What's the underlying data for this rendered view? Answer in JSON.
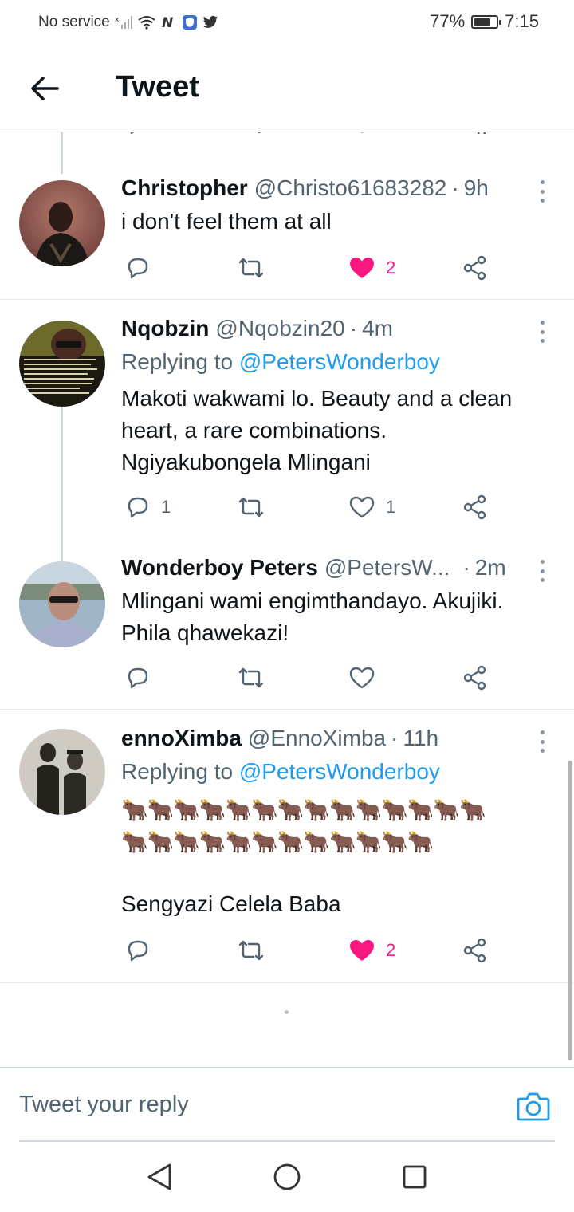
{
  "status_bar": {
    "carrier": "No service",
    "battery_percent": "77%",
    "battery_level": 0.77,
    "time": "7:15"
  },
  "header": {
    "title": "Tweet",
    "back_icon": "arrow-left-icon"
  },
  "colors": {
    "accent": "#1d9bf0",
    "like": "#f91880",
    "secondary_text": "#536471",
    "icon": "#536471"
  },
  "tweets": [
    {
      "name": "Christopher",
      "handle": "@Christo61683282",
      "time": "9h",
      "text": "i don't feel them at all",
      "replies": "",
      "retweets": "",
      "likes": "2",
      "liked": true
    },
    {
      "name": "Nqobzin",
      "handle": "@Nqobzin20",
      "time": "4m",
      "replying_label": "Replying to",
      "replying_to": "@PetersWonderboy",
      "text": "Makoti wakwami lo. Beauty and a clean heart, a rare combinations. Ngiyakubongela Mlingani",
      "replies": "1",
      "retweets": "",
      "likes": "1",
      "liked": false
    },
    {
      "name": "Wonderboy Peters",
      "handle": "@PetersW...",
      "time": "2m",
      "text": "Mlingani wami engimthandayo. Akujiki. Phila qhawekazi!",
      "replies": "",
      "retweets": "",
      "likes": "",
      "liked": false
    },
    {
      "name": "ennoXimba",
      "handle": "@EnnoXimba",
      "time": "11h",
      "replying_label": "Replying to",
      "replying_to": "@PetersWonderboy",
      "emoji_line_1": "🐂🐂🐂🐂🐂🐂🐂🐂🐂🐂🐂🐂🐂🐂",
      "emoji_line_2": "🐂🐂🐂🐂🐂🐂🐂🐂🐂🐂🐂🐂",
      "text": "Sengyazi Celela Baba",
      "replies": "",
      "retweets": "",
      "likes": "2",
      "liked": true
    }
  ],
  "reply_bar": {
    "placeholder": "Tweet your reply"
  }
}
